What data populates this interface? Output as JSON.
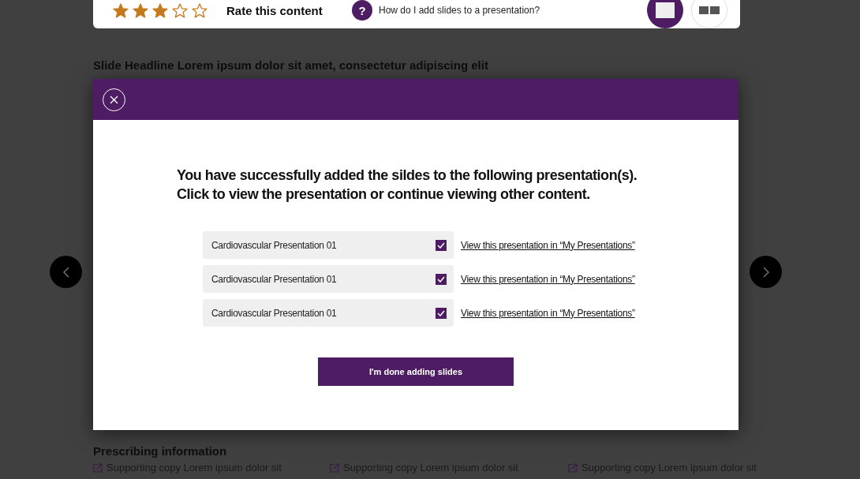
{
  "top_bar": {
    "rating": {
      "stars": 3
    },
    "rating_label": "Rate this content",
    "help": {
      "badge": "?",
      "question": "How do I add slides to a presentation?"
    },
    "view_buttons": [
      {
        "kind": "single",
        "selected": true
      },
      {
        "kind": "grid",
        "selected": false
      }
    ]
  },
  "headline": "Slide Headline Lorem ipsum dolor sit amet, consectetur adipiscing elit",
  "modal": {
    "message_lines": [
      "You have successfully added the sildes to the following presentation(s).",
      "Click to view the presentation or continue viewing other content."
    ],
    "presentations": [
      {
        "name": "Cardiovascular Presentation 01",
        "checked": true,
        "link": "View this presentation in “My Presentations”"
      },
      {
        "name": "Cardiovascular Presentation 01",
        "checked": true,
        "link": "View this presentation in “My Presentations”"
      },
      {
        "name": "Cardiovascular Presentation 01",
        "checked": true,
        "link": "View this presentation in “My Presentations”"
      }
    ],
    "done_button": "I'm done adding slides"
  },
  "prescribing": {
    "heading": "Prescribing information",
    "items": [
      "Supporting copy Lorem ipsum dolor sit",
      "Supporting copy Lorem ipsum dolor sit",
      "Supporting copy Lorem ipsum dolor sit"
    ]
  }
}
